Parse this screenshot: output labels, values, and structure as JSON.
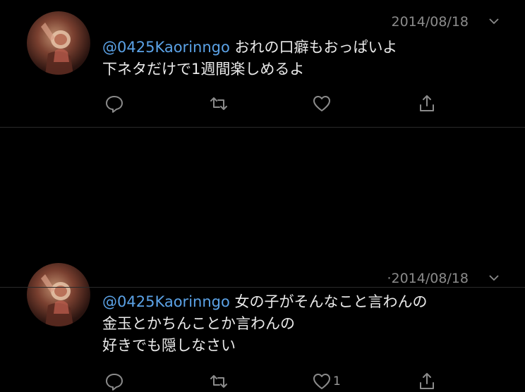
{
  "tweets": [
    {
      "handle": "@0425Kaorinngo",
      "date": "2014/08/18",
      "lines": [
        "おれの口癖もおっぱいよ",
        "下ネタだけで1週間楽しめるよ"
      ],
      "like_count": ""
    },
    {
      "handle": "@0425Kaorinngo",
      "date": "·2014/08/18",
      "lines": [
        "女の子がそんなこと言わんの",
        "金玉とかちんことか言わんの",
        "好きでも隠しなさい"
      ],
      "like_count": "1"
    }
  ],
  "icons": {
    "reply": "reply-icon",
    "retweet": "retweet-icon",
    "like": "heart-icon",
    "share": "share-icon",
    "more": "chevron-down-icon"
  },
  "colors": {
    "background": "#000000",
    "mention": "#5ba2e6",
    "muted": "#8b8b8b",
    "text": "#eaeaea"
  }
}
